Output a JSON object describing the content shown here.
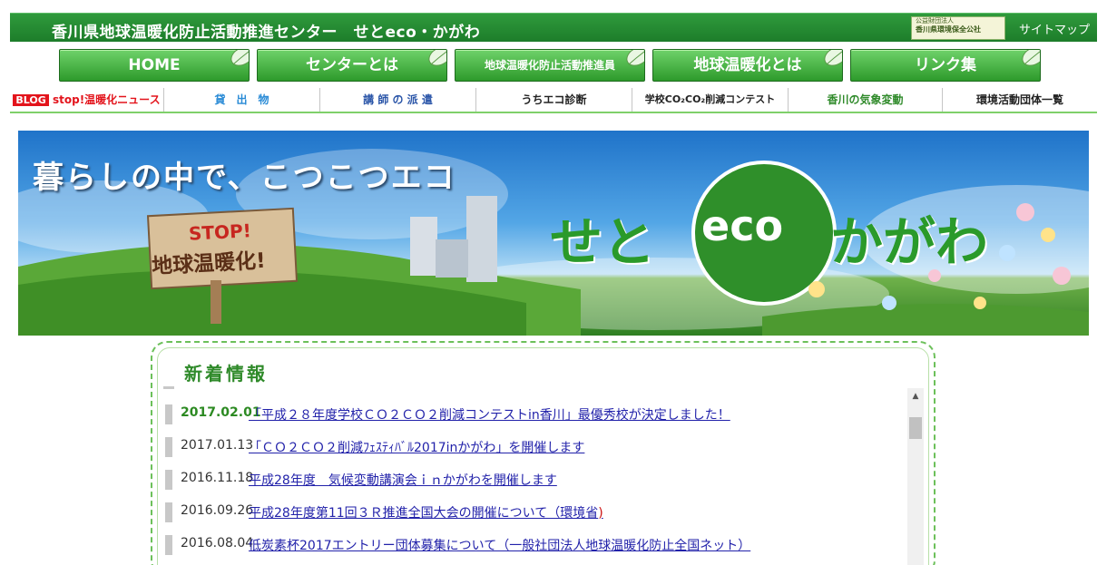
{
  "header": {
    "site_title": "香川県地球温暖化防止活動推進センター　せとeco・かがわ",
    "org_logo_line1": "公益財団法人",
    "org_logo_line2": "香川県環境保全公社",
    "sitemap_label": "サイトマップ"
  },
  "main_nav": [
    {
      "label": "HOME"
    },
    {
      "label": "センターとは"
    },
    {
      "label": "地球温暖化防止活動推進員"
    },
    {
      "label": "地球温暖化とは"
    },
    {
      "label": "リンク集"
    }
  ],
  "sub_nav": [
    {
      "badge": "BLOG",
      "label": "stop!温暖化ニュース",
      "color": "#e3141c"
    },
    {
      "label": "貸　出　物",
      "color": "#2a8bd6"
    },
    {
      "label": "講 師 の 派 遣",
      "color": "#2a55a8"
    },
    {
      "label": "うちエコ診断",
      "color": "#222222"
    },
    {
      "label": "学校CO₂CO₂削減コンテスト",
      "color": "#222222"
    },
    {
      "label": "香川の気象変動",
      "color": "#2f8a2a"
    },
    {
      "label": "環境活動団体一覧",
      "color": "#222222"
    }
  ],
  "banner": {
    "tagline": "暮らしの中で、こつこつエコ",
    "sign_line1": "STOP!",
    "sign_line2": "地球温暖化!",
    "logo_left": "せと",
    "logo_eco": "eco",
    "logo_right": "かがわ"
  },
  "news": {
    "title": "新着情報",
    "items": [
      {
        "date": "2017.02.01",
        "text": "「平成２８年度学校ＣＯ２ＣＯ２削減コンテストin香川」最優秀校が決定しました！",
        "highlight": true
      },
      {
        "date": "2017.01.13",
        "text": "「ＣＯ２ＣＯ２削減ﾌｪｽﾃｨﾊﾞﾙ2017inかがわ」を開催します"
      },
      {
        "date": "2016.11.18",
        "text": "平成28年度　気候変動講演会ｉｎかがわを開催します"
      },
      {
        "date": "2016.09.26",
        "text": "平成28年度第11回３Ｒ推進全国大会の開催について（環境省",
        "paren": ")"
      },
      {
        "date": "2016.08.04",
        "text": "低炭素杯2017エントリー団体募集について（一般社団法人地球温暖化防止全国ネット）"
      }
    ]
  },
  "colors": {
    "header_green": "#1d7d2a",
    "nav_green": "#2d9a2b",
    "link_blue": "#2222aa",
    "date_highlight": "#2c8a22"
  }
}
